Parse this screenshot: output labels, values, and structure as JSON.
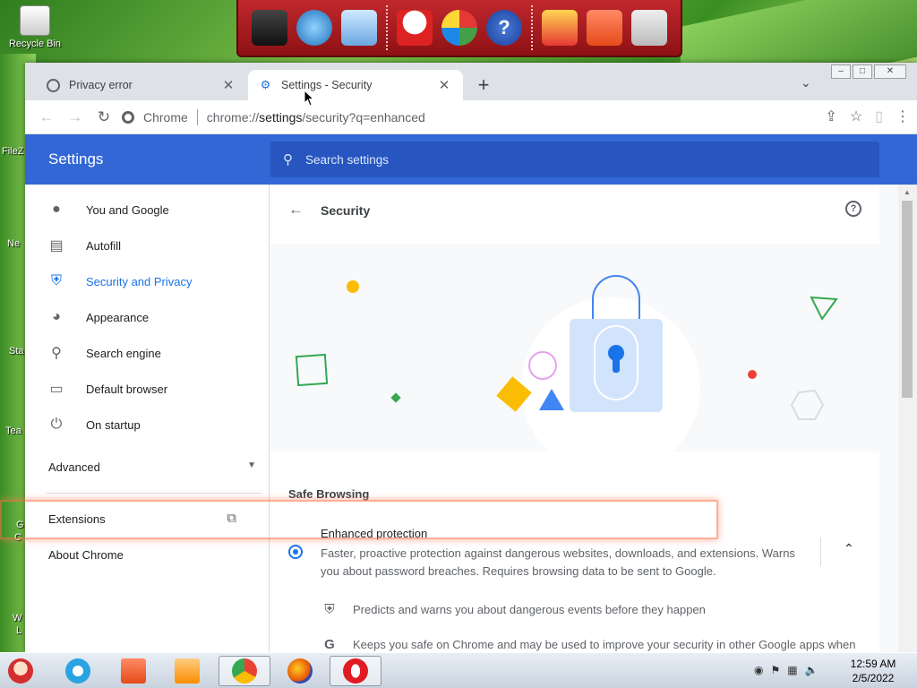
{
  "desktop": {
    "recycle_bin_label": "Recycle Bin",
    "partial_labels": [
      "FileZ",
      "Ne",
      "Sta",
      "Tea",
      "G",
      "C",
      "W",
      "L"
    ]
  },
  "browser": {
    "tabs": [
      {
        "title": "Privacy error",
        "active": false
      },
      {
        "title": "Settings - Security",
        "active": true
      }
    ],
    "omnibox": {
      "site_label": "Chrome",
      "url_prefix": "chrome://",
      "url_host": "settings",
      "url_rest": "/security?q=enhanced"
    }
  },
  "settings": {
    "header_title": "Settings",
    "search_placeholder": "Search settings",
    "nav": [
      {
        "label": "You and Google",
        "icon": "person-icon"
      },
      {
        "label": "Autofill",
        "icon": "clipboard-icon"
      },
      {
        "label": "Security and Privacy",
        "icon": "shield-icon",
        "active": true
      },
      {
        "label": "Appearance",
        "icon": "palette-icon"
      },
      {
        "label": "Search engine",
        "icon": "search-icon"
      },
      {
        "label": "Default browser",
        "icon": "browser-icon"
      },
      {
        "label": "On startup",
        "icon": "power-icon"
      }
    ],
    "advanced_label": "Advanced",
    "extensions_label": "Extensions",
    "about_label": "About Chrome",
    "page_title": "Security",
    "safe_browsing_heading": "Safe Browsing",
    "enhanced": {
      "title": "Enhanced protection",
      "description": "Faster, proactive protection against dangerous websites, downloads, and extensions. Warns you about password breaches. Requires browsing data to be sent to Google.",
      "selected": true
    },
    "bullets": [
      {
        "text": "Predicts and warns you about dangerous events before they happen",
        "icon": "shield-icon"
      },
      {
        "text": "Keeps you safe on Chrome and may be used to improve your security in other Google apps when",
        "icon": "google-g-icon"
      }
    ]
  },
  "taskbar": {
    "time": "12:59 AM",
    "date": "2/5/2022"
  },
  "colors": {
    "accent": "#1a73e8",
    "header_blue": "#3367d6"
  }
}
